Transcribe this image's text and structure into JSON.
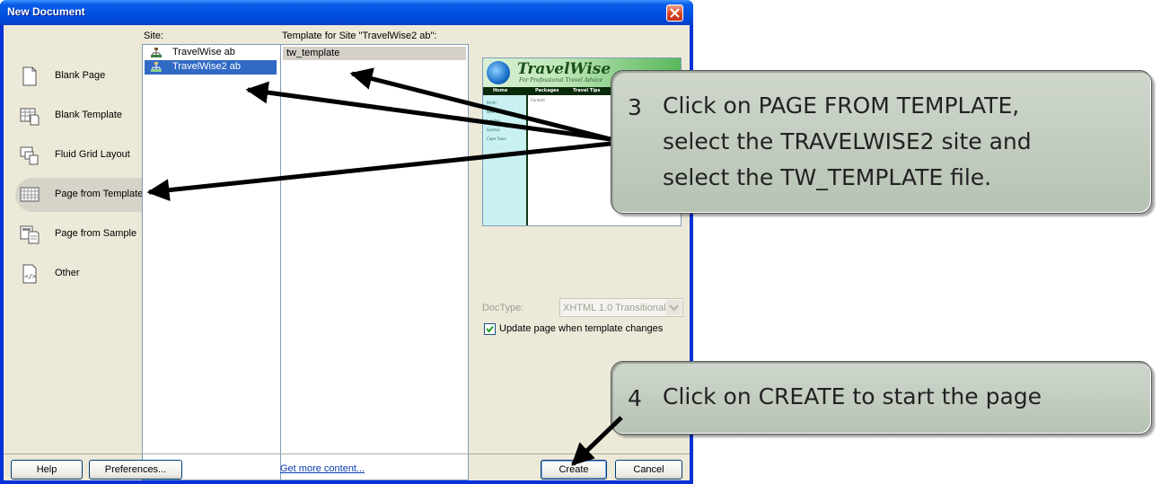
{
  "window": {
    "title": "New Document"
  },
  "categories": [
    {
      "label": "Blank Page",
      "icon": "blank-page-icon",
      "selected": false
    },
    {
      "label": "Blank Template",
      "icon": "blank-template-icon",
      "selected": false
    },
    {
      "label": "Fluid Grid Layout",
      "icon": "fluid-grid-icon",
      "selected": false
    },
    {
      "label": "Page from Template",
      "icon": "page-from-template-icon",
      "selected": true
    },
    {
      "label": "Page from Sample",
      "icon": "page-from-sample-icon",
      "selected": false
    },
    {
      "label": "Other",
      "icon": "other-code-icon",
      "selected": false
    }
  ],
  "site": {
    "header": "Site:",
    "items": [
      {
        "label": "TravelWise ab",
        "selected": false
      },
      {
        "label": "TravelWise2 ab",
        "selected": true
      }
    ]
  },
  "templates": {
    "header": "Template for Site \"TravelWise2 ab\":",
    "items": [
      {
        "label": "tw_template",
        "selected": true
      }
    ]
  },
  "preview": {
    "title": "TravelWise",
    "subtitle": "For Professional Travel Advice",
    "nav": [
      "Home",
      "Packages",
      "Travel Tips",
      "A"
    ],
    "content_label": "Content",
    "side_links": [
      "Perth",
      "New York",
      "London",
      "Sydney",
      "Cape Town"
    ]
  },
  "doctype": {
    "label": "DocType:",
    "value": "XHTML 1.0 Transitional",
    "enabled": false
  },
  "update_checkbox": {
    "label": "Update page when template changes",
    "checked": true
  },
  "footer": {
    "help": "Help",
    "preferences": "Preferences...",
    "get_more": "Get more content...",
    "create": "Create",
    "cancel": "Cancel"
  },
  "callouts": [
    {
      "number": "3",
      "lines": [
        "Click on PAGE FROM TEMPLATE,",
        "select the TRAVELWISE2 site and",
        "select the TW_TEMPLATE file."
      ]
    },
    {
      "number": "4",
      "lines": [
        "Click on CREATE to start the page"
      ]
    }
  ],
  "colors": {
    "titlebar": "#0054e3",
    "selection": "#316ac5",
    "dialog_bg": "#ece9d8",
    "callout_bg": "#c4cec2"
  }
}
